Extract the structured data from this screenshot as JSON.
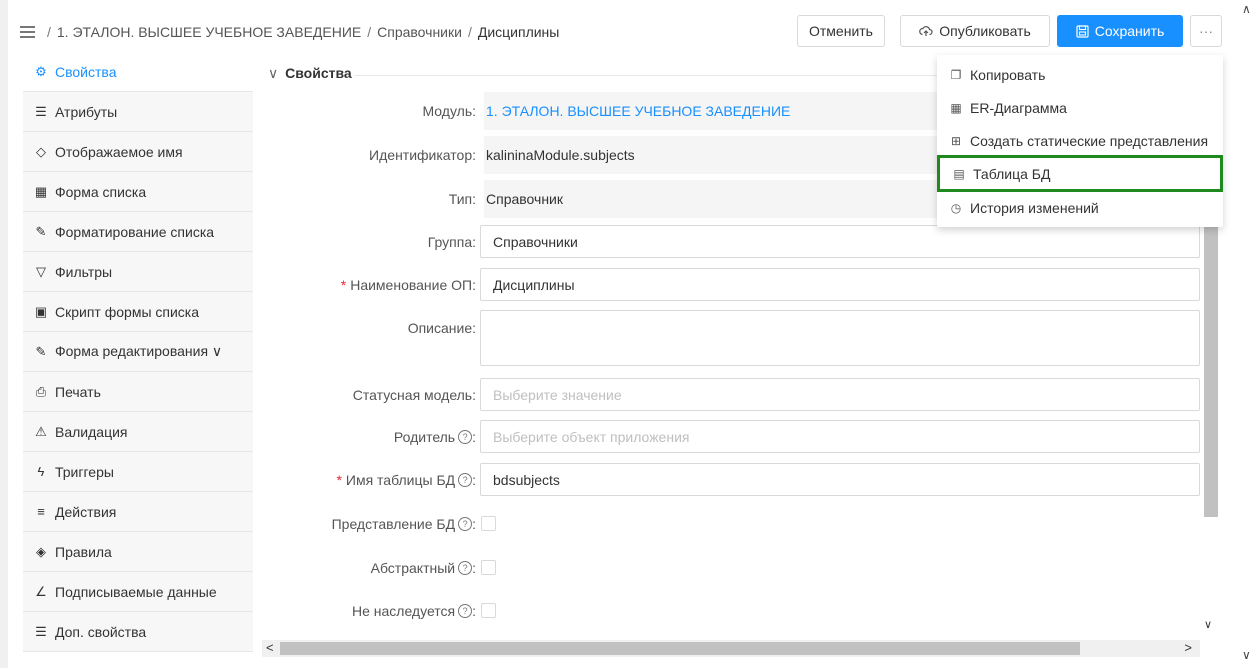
{
  "header": {
    "breadcrumb": [
      "1. ЭТАЛОН. ВЫСШЕЕ УЧЕБНОЕ ЗАВЕДЕНИЕ",
      "Справочники",
      "Дисциплины"
    ],
    "separator": "/",
    "buttons": {
      "cancel": "Отменить",
      "publish": "Опубликовать",
      "save": "Сохранить",
      "more": "···"
    }
  },
  "sidebar": {
    "items": [
      {
        "icon": "gear-icon",
        "glyph": "⚙",
        "label": "Свойства"
      },
      {
        "icon": "list-icon",
        "glyph": "☰",
        "label": "Атрибуты"
      },
      {
        "icon": "tag-icon",
        "glyph": "◇",
        "label": "Отображаемое имя"
      },
      {
        "icon": "table-icon",
        "glyph": "▦",
        "label": "Форма списка"
      },
      {
        "icon": "brush-icon",
        "glyph": "✎",
        "label": "Форматирование списка"
      },
      {
        "icon": "filter-icon",
        "glyph": "▽",
        "label": "Фильтры"
      },
      {
        "icon": "terminal-icon",
        "glyph": "▣",
        "label": "Скрипт формы списка"
      },
      {
        "icon": "edit-icon",
        "glyph": "✎",
        "label": "Форма редактирования ∨"
      },
      {
        "icon": "printer-icon",
        "glyph": "⎙",
        "label": "Печать"
      },
      {
        "icon": "warning-icon",
        "glyph": "⚠",
        "label": "Валидация"
      },
      {
        "icon": "lightning-icon",
        "glyph": "ϟ",
        "label": "Триггеры"
      },
      {
        "icon": "menu-icon",
        "glyph": "≡",
        "label": "Действия"
      },
      {
        "icon": "rules-icon",
        "glyph": "◈",
        "label": "Правила"
      },
      {
        "icon": "signature-icon",
        "glyph": "∠",
        "label": "Подписываемые данные"
      },
      {
        "icon": "list-icon",
        "glyph": "☰",
        "label": "Доп. свойства"
      }
    ]
  },
  "section": {
    "title": "Свойства",
    "caret": "∨"
  },
  "fields": {
    "module": {
      "label": "Модуль:",
      "value": "1. ЭТАЛОН. ВЫСШЕЕ УЧЕБНОЕ ЗАВЕДЕНИЕ"
    },
    "identifier": {
      "label": "Идентификатор:",
      "value": "kalininaModule.subjects"
    },
    "type": {
      "label": "Тип:",
      "value": "Справочник"
    },
    "group": {
      "label": "Группа:",
      "value": "Справочники"
    },
    "name": {
      "label": "Наименование ОП:",
      "value": "Дисциплины"
    },
    "description": {
      "label": "Описание:",
      "value": ""
    },
    "status_model": {
      "label": "Статусная модель:",
      "placeholder": "Выберите значение"
    },
    "parent": {
      "label": "Родитель",
      "placeholder": "Выберите объект приложения"
    },
    "db_table": {
      "label": "Имя таблицы БД",
      "value": "bdsubjects"
    },
    "db_view": {
      "label": "Представление БД"
    },
    "abstract": {
      "label": "Абстрактный"
    },
    "not_inherited": {
      "label": "Не наследуется"
    }
  },
  "dropdown": {
    "items": [
      {
        "icon": "copy-icon",
        "glyph": "❐",
        "label": "Копировать"
      },
      {
        "icon": "er-diagram-icon",
        "glyph": "▦",
        "label": "ER-Диаграмма"
      },
      {
        "icon": "static-views-icon",
        "glyph": "⊞",
        "label": "Создать статические представления"
      },
      {
        "icon": "db-table-icon",
        "glyph": "▤",
        "label": "Таблица БД"
      },
      {
        "icon": "history-icon",
        "glyph": "◷",
        "label": "История изменений"
      }
    ]
  },
  "colors": {
    "accent": "#1890ff",
    "highlight": "#1e8a1e",
    "required": "#f5222d"
  }
}
